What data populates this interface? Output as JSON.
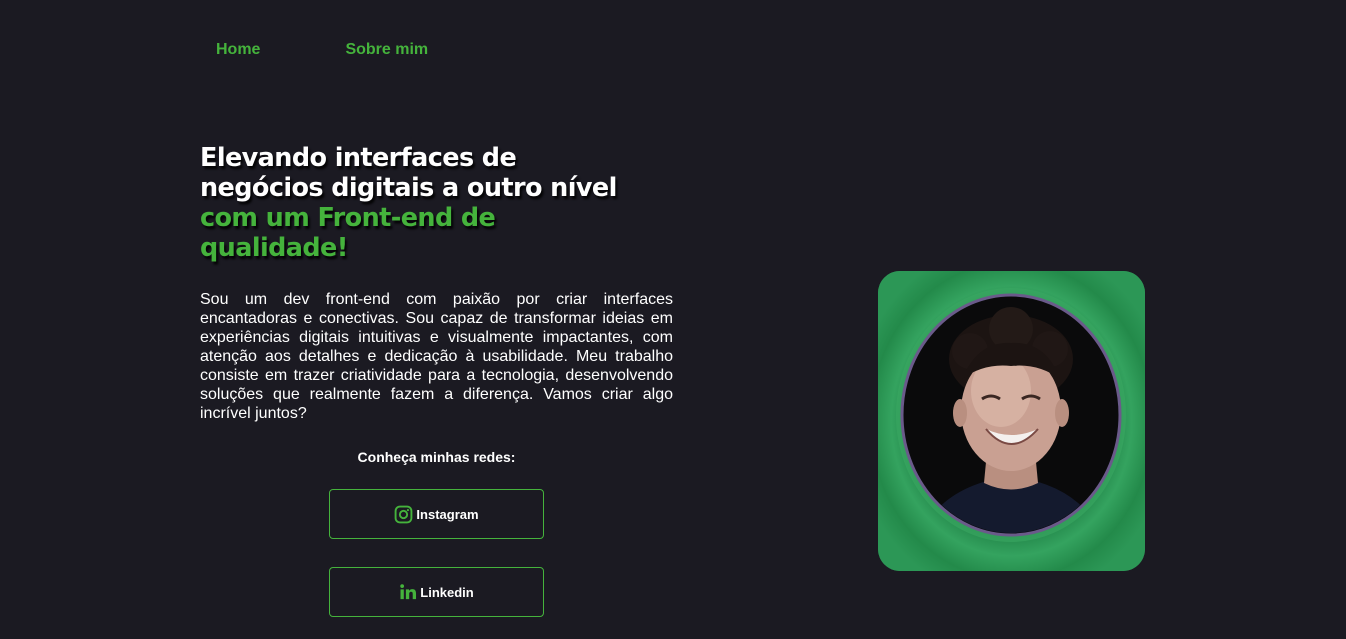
{
  "nav": {
    "home": "Home",
    "about": "Sobre mim"
  },
  "hero": {
    "title_line1": "Elevando interfaces de",
    "title_line2": "negócios digitais a outro nível",
    "title_line3": "com um Front-end de",
    "title_line4": "qualidade!"
  },
  "bio": "Sou um dev front-end com paixão por criar interfaces encantadoras e conectivas. Sou capaz de transformar ideias em experiências digitais intuitivas e visualmente impactantes, com atenção aos detalhes e dedicação à usabilidade. Meu trabalho consiste em trazer criatividade para a tecnologia, desenvolvendo soluções que realmente fazem a diferença. Vamos criar algo incrível juntos?",
  "networks": {
    "title": "Conheça minhas redes:",
    "instagram": {
      "label": "Instagram",
      "icon": "instagram-icon"
    },
    "linkedin": {
      "label": "Linkedin",
      "icon": "linkedin-icon"
    }
  },
  "colors": {
    "background": "#1b1a22",
    "accent": "#45b33c",
    "text": "#ffffff",
    "photo_frame": "#238d4a"
  }
}
